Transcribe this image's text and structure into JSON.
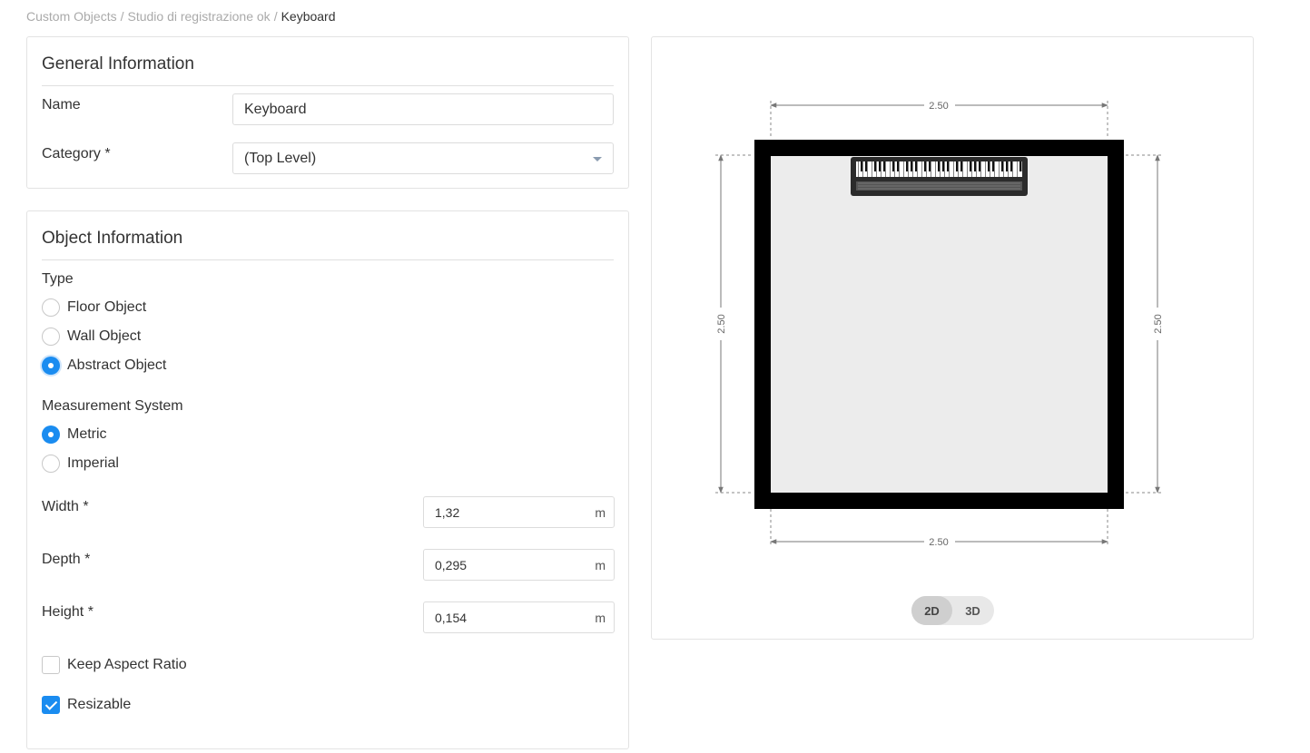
{
  "breadcrumb": {
    "items": [
      "Custom Objects",
      "Studio di registrazione ok"
    ],
    "separator": "/",
    "current": "Keyboard"
  },
  "general": {
    "title": "General Information",
    "name_label": "Name",
    "name_value": "Keyboard",
    "category_label": "Category *",
    "category_value": "(Top Level)"
  },
  "object": {
    "title": "Object Information",
    "type_label": "Type",
    "type_options": [
      "Floor Object",
      "Wall Object",
      "Abstract Object"
    ],
    "type_selected": "Abstract Object",
    "measurement_label": "Measurement System",
    "measurement_options": [
      "Metric",
      "Imperial"
    ],
    "measurement_selected": "Metric",
    "width_label": "Width *",
    "width_value": "1,32",
    "depth_label": "Depth *",
    "depth_value": "0,295",
    "height_label": "Height *",
    "height_value": "0,154",
    "unit": "m",
    "keep_aspect_label": "Keep Aspect Ratio",
    "keep_aspect_checked": false,
    "resizable_label": "Resizable",
    "resizable_checked": true
  },
  "preview": {
    "dim_top": "2.50",
    "dim_bottom": "2.50",
    "dim_left": "2.50",
    "dim_right": "2.50",
    "view_2d": "2D",
    "view_3d": "3D",
    "active_view": "2D",
    "accent_color": "#1a8cf0"
  }
}
